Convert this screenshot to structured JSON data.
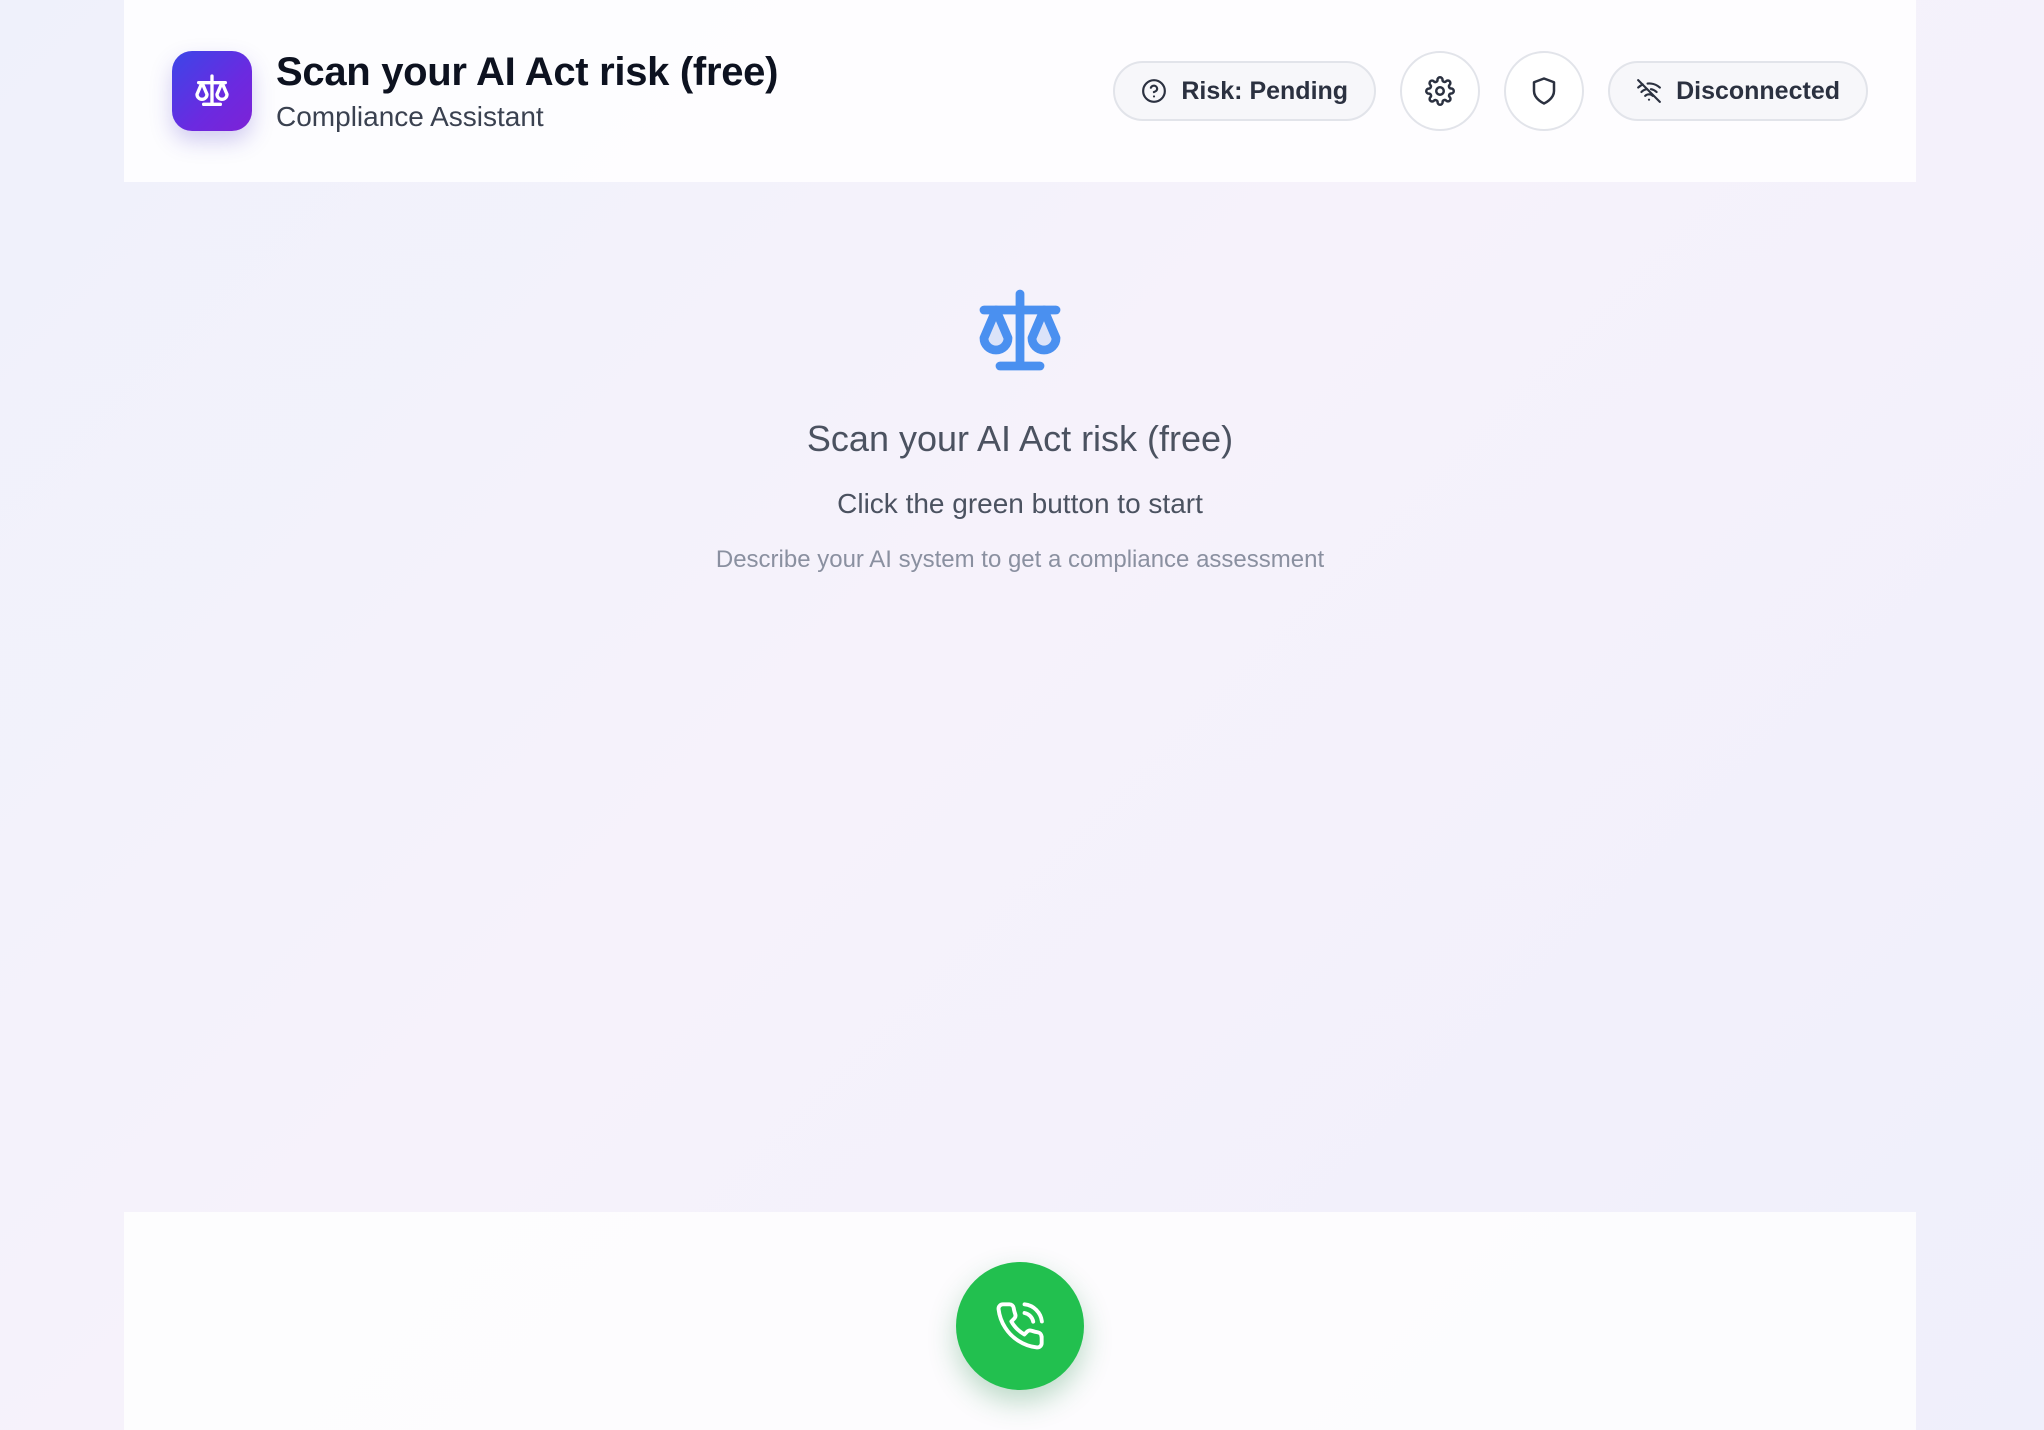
{
  "header": {
    "title": "Scan your AI Act risk (free)",
    "subtitle": "Compliance Assistant",
    "app_icon": "scale-icon",
    "risk_pill": {
      "label": "Risk: Pending",
      "icon": "question-circle-icon"
    },
    "settings_button": {
      "icon": "gear-icon"
    },
    "privacy_button": {
      "icon": "shield-icon"
    },
    "connection_pill": {
      "label": "Disconnected",
      "icon": "wifi-off-icon"
    }
  },
  "hero": {
    "icon": "scale-icon",
    "title": "Scan your AI Act risk (free)",
    "subtitle": "Click the green button to start",
    "hint": "Describe your AI system to get a compliance assessment"
  },
  "footer": {
    "call_button": {
      "icon": "phone-call-icon"
    }
  },
  "colors": {
    "brand_gradient_start": "#3b46e8",
    "brand_gradient_end": "#7d22d6",
    "hero_icon": "#4a90f0",
    "call_button": "#22c04f"
  }
}
